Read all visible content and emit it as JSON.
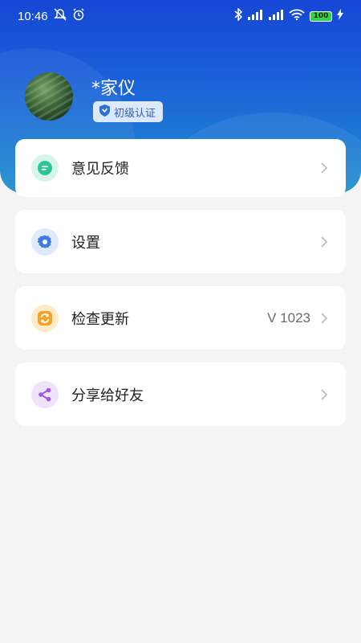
{
  "status_bar": {
    "time": "10:46",
    "battery": "100"
  },
  "profile": {
    "username": "*家仪",
    "badge": "初级认证"
  },
  "menu": [
    {
      "label": "意见反馈",
      "icon": "chat-bubble-icon",
      "color": "#2ec49a"
    },
    {
      "label": "设置",
      "icon": "gear-icon",
      "color": "#3f7be0"
    },
    {
      "label": "检查更新",
      "icon": "refresh-icon",
      "color": "#f4a32a",
      "value": "V 1023"
    },
    {
      "label": "分享给好友",
      "icon": "share-icon",
      "color": "#9b59e6"
    }
  ],
  "colors": {
    "header_top": "#1547d6",
    "header_bottom": "#1f8ecf",
    "page_bg": "#f4f4f5"
  }
}
